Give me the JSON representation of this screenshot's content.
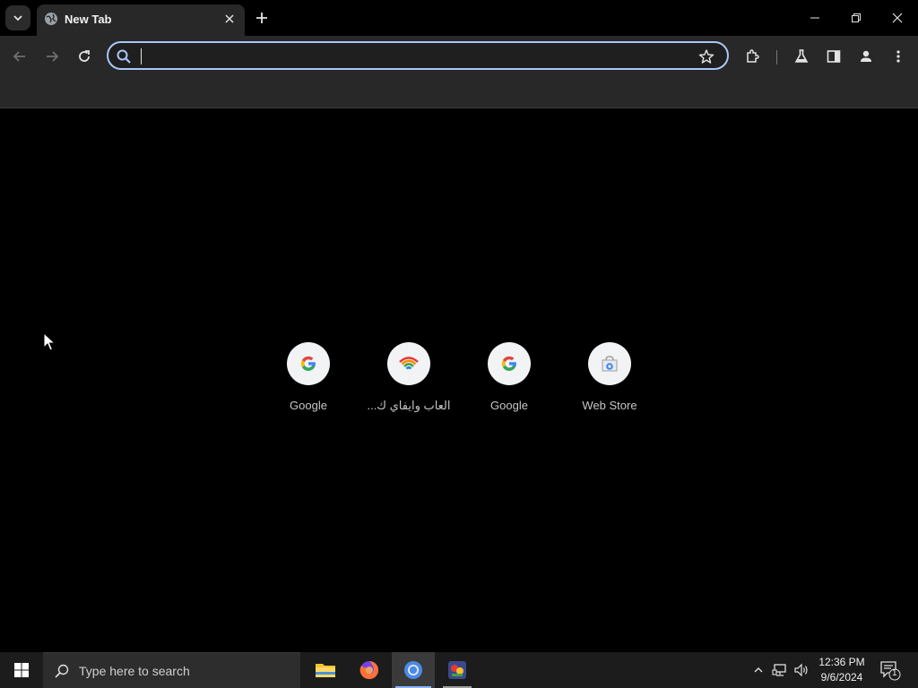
{
  "browser": {
    "tab": {
      "title": "New Tab"
    },
    "omnibox": {
      "value": "",
      "placeholder": ""
    }
  },
  "ntp": {
    "shortcuts": [
      {
        "label": "Google",
        "icon": "google-g-icon"
      },
      {
        "label": "العاب وايفاي ك...",
        "icon": "wifi-rainbow-icon"
      },
      {
        "label": "Google",
        "icon": "google-g-icon"
      },
      {
        "label": "Web Store",
        "icon": "web-store-icon"
      }
    ]
  },
  "taskbar": {
    "search_placeholder": "Type here to search",
    "clock_time": "12:36 PM",
    "clock_date": "9/6/2024",
    "notification_count": "1"
  },
  "colors": {
    "accent": "#a8c7fa",
    "tab_bg": "#282828",
    "page_bg": "#000000",
    "taskbar_bg": "#1c1c1c"
  }
}
